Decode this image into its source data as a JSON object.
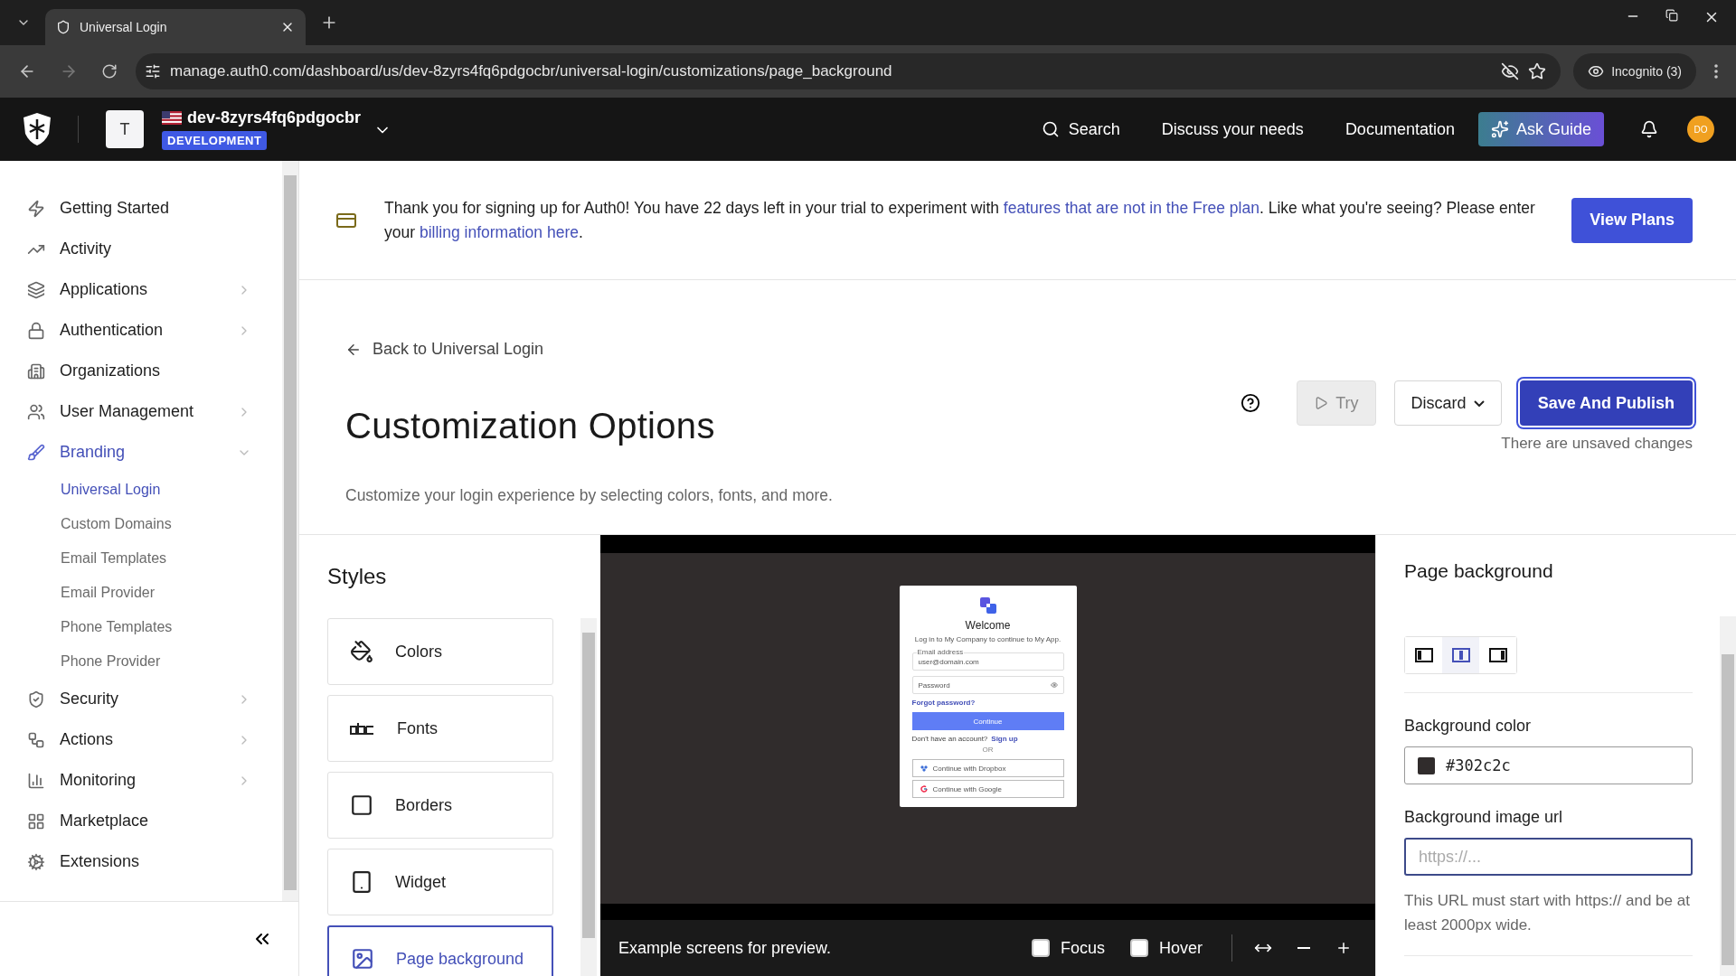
{
  "browser": {
    "tabs": [
      {
        "title": "Universal Login",
        "selected": true
      }
    ],
    "url": "manage.auth0.com/dashboard/us/dev-8zyrs4fq6pdgocbr/universal-login/customizations/page_background",
    "incognito": "Incognito (3)"
  },
  "header": {
    "tenant_initial": "T",
    "tenant_name": "dev-8zyrs4fq6pdgocbr",
    "environment": "DEVELOPMENT",
    "search": "Search",
    "links": [
      "Discuss your needs",
      "Documentation"
    ],
    "ask_guide": "Ask Guide",
    "avatar": "DO"
  },
  "sidebar": {
    "items": [
      {
        "label": "Getting Started",
        "selected": false,
        "has_submenu": false
      },
      {
        "label": "Activity",
        "selected": false,
        "has_submenu": false
      },
      {
        "label": "Applications",
        "selected": false,
        "has_submenu": true,
        "expanded": false
      },
      {
        "label": "Authentication",
        "selected": false,
        "has_submenu": true,
        "expanded": false
      },
      {
        "label": "Organizations",
        "selected": false,
        "has_submenu": false
      },
      {
        "label": "User Management",
        "selected": false,
        "has_submenu": true,
        "expanded": false
      },
      {
        "label": "Branding",
        "selected": true,
        "has_submenu": true,
        "expanded": true,
        "children": [
          {
            "label": "Universal Login",
            "selected": true
          },
          {
            "label": "Custom Domains",
            "selected": false
          },
          {
            "label": "Email Templates",
            "selected": false
          },
          {
            "label": "Email Provider",
            "selected": false
          },
          {
            "label": "Phone Templates",
            "selected": false
          },
          {
            "label": "Phone Provider",
            "selected": false
          }
        ]
      },
      {
        "label": "Security",
        "selected": false,
        "has_submenu": true,
        "expanded": false
      },
      {
        "label": "Actions",
        "selected": false,
        "has_submenu": true,
        "expanded": false
      },
      {
        "label": "Monitoring",
        "selected": false,
        "has_submenu": true,
        "expanded": false
      },
      {
        "label": "Marketplace",
        "selected": false,
        "has_submenu": false
      },
      {
        "label": "Extensions",
        "selected": false,
        "has_submenu": false
      }
    ]
  },
  "banner": {
    "parts": [
      {
        "text": "Thank you for signing up for Auth0! You have 22 days left in your trial to experiment with ",
        "link": false
      },
      {
        "text": "features that are not in the Free plan",
        "link": true
      },
      {
        "text": ". Like what you're seeing? Please enter your ",
        "link": false
      },
      {
        "text": "billing information here",
        "link": true
      },
      {
        "text": ".",
        "link": false
      }
    ],
    "button": "View Plans"
  },
  "page": {
    "back_link": "Back to Universal Login",
    "title": "Customization Options",
    "description": "Customize your login experience by selecting colors, fonts, and more.",
    "try": {
      "label": "Try",
      "disabled": true
    },
    "discard": "Discard",
    "save": "Save And Publish",
    "unsaved_note": "There are unsaved changes"
  },
  "styles": {
    "title": "Styles",
    "items": [
      {
        "label": "Colors",
        "selected": false
      },
      {
        "label": "Fonts",
        "selected": false
      },
      {
        "label": "Borders",
        "selected": false
      },
      {
        "label": "Widget",
        "selected": false
      },
      {
        "label": "Page background",
        "selected": true
      }
    ]
  },
  "preview": {
    "card": {
      "title": "Welcome",
      "subtitle": "Log in to My Company to continue to My App.",
      "email_label": "Email address",
      "email_value": "user@domain.com",
      "password_placeholder": "Password",
      "forgot": "Forgot password?",
      "continue": "Continue",
      "signup_prompt": "Don't have an account?",
      "signup_link": "Sign up",
      "divider": "OR",
      "social": [
        "Continue with Dropbox",
        "Continue with Google"
      ]
    },
    "caption": "Example screens for preview.",
    "toggles": [
      {
        "label": "Focus",
        "checked": false
      },
      {
        "label": "Hover",
        "checked": false
      }
    ]
  },
  "panel": {
    "title": "Page background",
    "layouts": [
      {
        "kind": "left",
        "selected": false
      },
      {
        "kind": "center",
        "selected": true
      },
      {
        "kind": "right",
        "selected": false
      }
    ],
    "background_color": {
      "label": "Background color",
      "value": "#302c2c",
      "color": "#302c2c"
    },
    "background_image": {
      "label": "Background image url",
      "placeholder": "https://...",
      "help": "This URL must start with https:// and be at least 2000px wide."
    }
  }
}
